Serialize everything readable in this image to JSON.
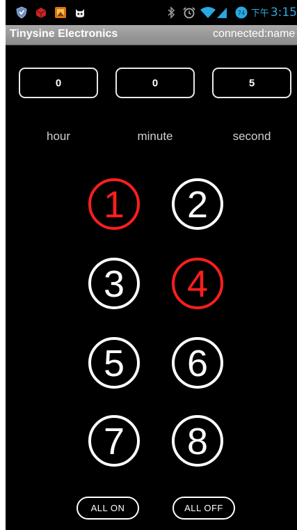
{
  "status_bar": {
    "time": "3:15",
    "ampm": "下午",
    "clock_color": "#2aa8e0",
    "notification_icons": [
      "shield-icon",
      "cube-icon",
      "app-icon",
      "cat-icon"
    ],
    "system_icons": [
      "bluetooth-icon",
      "alarm-icon",
      "wifi-icon",
      "signal-icon",
      "battery-icon"
    ],
    "battery_level": "74"
  },
  "app": {
    "title": "Tinysine Electronics",
    "connection": "connected:name"
  },
  "timer": {
    "hour": "0",
    "minute": "0",
    "second": "5",
    "hour_label": "hour",
    "minute_label": "minute",
    "second_label": "second"
  },
  "relays": [
    {
      "label": "1",
      "state": "on"
    },
    {
      "label": "2",
      "state": "off"
    },
    {
      "label": "3",
      "state": "off"
    },
    {
      "label": "4",
      "state": "on"
    },
    {
      "label": "5",
      "state": "off"
    },
    {
      "label": "6",
      "state": "off"
    },
    {
      "label": "7",
      "state": "off"
    },
    {
      "label": "8",
      "state": "off"
    }
  ],
  "controls": {
    "all_on": "ALL ON",
    "all_off": "ALL OFF"
  },
  "colors": {
    "on": "#ff1e1e",
    "off": "#ffffff",
    "background": "#000000"
  }
}
